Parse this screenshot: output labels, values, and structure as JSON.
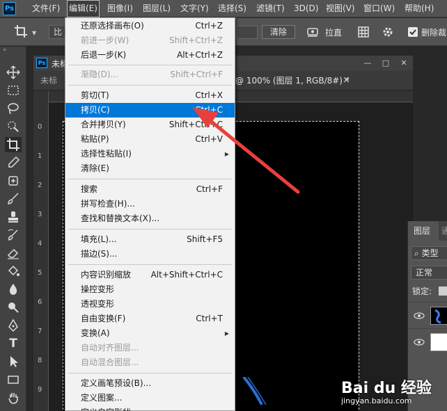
{
  "menubar": {
    "logo": "Ps",
    "items": [
      {
        "label": "文件(F)",
        "active": false
      },
      {
        "label": "编辑(E)",
        "active": true
      },
      {
        "label": "图像(I)",
        "active": false
      },
      {
        "label": "图层(L)",
        "active": false
      },
      {
        "label": "文字(Y)",
        "active": false
      },
      {
        "label": "选择(S)",
        "active": false
      },
      {
        "label": "滤镜(T)",
        "active": false
      },
      {
        "label": "3D(D)",
        "active": false
      },
      {
        "label": "视图(V)",
        "active": false
      },
      {
        "label": "窗口(W)",
        "active": false
      },
      {
        "label": "帮助(H)",
        "active": false
      }
    ]
  },
  "options_bar": {
    "ratio_label": "比",
    "clear_button": "清除",
    "straighten_label": "拉直",
    "delete_crop_label": "删除裁"
  },
  "document": {
    "logo": "Ps",
    "window_title": "未标",
    "tab_inactive": "未标",
    "tab_active": "@ 100% (图层 1, RGB/8#) *",
    "tab_close": "×",
    "ruler_left_numbers": [
      "0",
      "1",
      "2",
      "3",
      "4",
      "5",
      "6",
      "7",
      "8",
      "9",
      "1"
    ]
  },
  "edit_menu": {
    "items": [
      {
        "label": "还原选择画布(O)",
        "shortcut": "Ctrl+Z",
        "disabled": false
      },
      {
        "label": "前进一步(W)",
        "shortcut": "Shift+Ctrl+Z",
        "disabled": true
      },
      {
        "label": "后退一步(K)",
        "shortcut": "Alt+Ctrl+Z",
        "disabled": false
      },
      {
        "separator": true
      },
      {
        "label": "渐隐(D)...",
        "shortcut": "Shift+Ctrl+F",
        "disabled": true
      },
      {
        "separator": true
      },
      {
        "label": "剪切(T)",
        "shortcut": "Ctrl+X",
        "disabled": false
      },
      {
        "label": "拷贝(C)",
        "shortcut": "Ctrl+C",
        "disabled": false,
        "highlighted": true
      },
      {
        "label": "合并拷贝(Y)",
        "shortcut": "Shift+Ctrl+C",
        "disabled": false
      },
      {
        "label": "粘贴(P)",
        "shortcut": "Ctrl+V",
        "disabled": false
      },
      {
        "label": "选择性粘贴(I)",
        "shortcut": "",
        "disabled": false,
        "submenu": true
      },
      {
        "label": "清除(E)",
        "shortcut": "",
        "disabled": false
      },
      {
        "separator": true
      },
      {
        "label": "搜索",
        "shortcut": "Ctrl+F",
        "disabled": false
      },
      {
        "label": "拼写检查(H)...",
        "shortcut": "",
        "disabled": false
      },
      {
        "label": "查找和替换文本(X)...",
        "shortcut": "",
        "disabled": false
      },
      {
        "separator": true
      },
      {
        "label": "填充(L)...",
        "shortcut": "Shift+F5",
        "disabled": false
      },
      {
        "label": "描边(S)...",
        "shortcut": "",
        "disabled": false
      },
      {
        "separator": true
      },
      {
        "label": "内容识别缩放",
        "shortcut": "Alt+Shift+Ctrl+C",
        "disabled": false
      },
      {
        "label": "操控变形",
        "shortcut": "",
        "disabled": false
      },
      {
        "label": "透视变形",
        "shortcut": "",
        "disabled": false
      },
      {
        "label": "自由变换(F)",
        "shortcut": "Ctrl+T",
        "disabled": false
      },
      {
        "label": "变换(A)",
        "shortcut": "",
        "disabled": false,
        "submenu": true
      },
      {
        "label": "自动对齐图层...",
        "shortcut": "",
        "disabled": true
      },
      {
        "label": "自动混合图层...",
        "shortcut": "",
        "disabled": true
      },
      {
        "separator": true
      },
      {
        "label": "定义画笔预设(B)...",
        "shortcut": "",
        "disabled": false
      },
      {
        "label": "定义图案...",
        "shortcut": "",
        "disabled": false
      },
      {
        "label": "定义自定形状...",
        "shortcut": "",
        "disabled": false
      }
    ]
  },
  "layers_panel": {
    "tab_layers": "图层",
    "tab_other": "通",
    "search_label": "类型",
    "blend_mode": "正常",
    "lock_label": "锁定:"
  },
  "watermark": {
    "brand": "Bai du 经验",
    "url": "jingyan.baidu.com"
  },
  "colors": {
    "menu_highlight": "#0078d7",
    "arrow": "#e8403c",
    "ps_blue": "#31a8ff"
  }
}
